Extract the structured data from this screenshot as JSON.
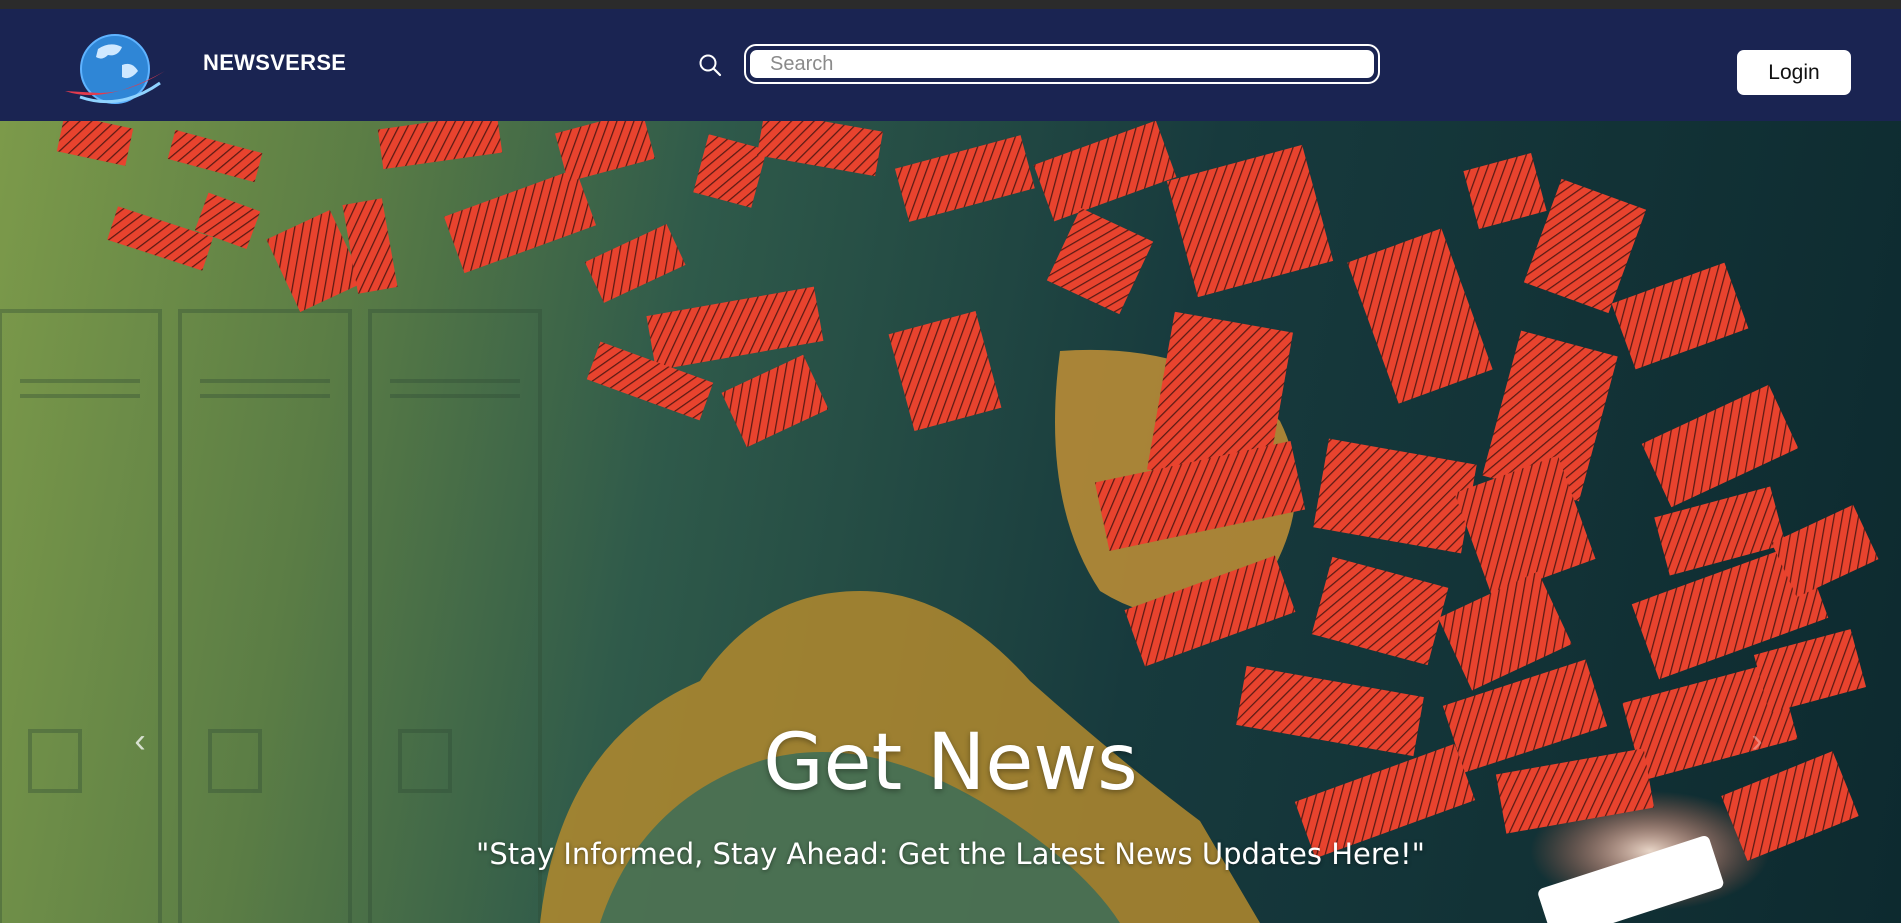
{
  "navbar": {
    "brand": "NEWSVERSE",
    "logo_icon": "globe-logo-icon",
    "search_icon": "search-icon",
    "search_placeholder": "Search",
    "search_value": "",
    "login_label": "Login"
  },
  "hero": {
    "title": "Get News",
    "subtitle": "\"Stay Informed, Stay Ahead: Get the Latest News Updates Here!\"",
    "prev_icon": "chevron-left-icon",
    "next_icon": "chevron-right-icon",
    "prev_glyph": "‹",
    "next_glyph": "›"
  },
  "colors": {
    "navbar_bg": "#1a2452",
    "accent_red": "#e8432e",
    "text_white": "#ffffff"
  }
}
